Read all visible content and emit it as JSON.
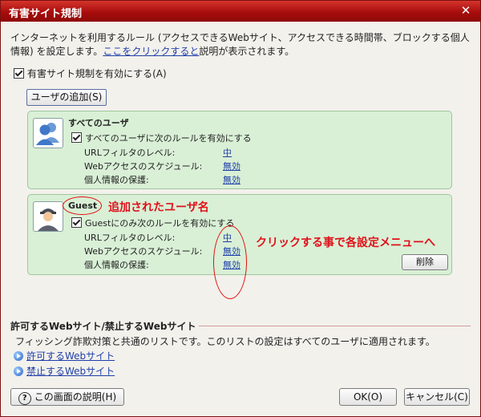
{
  "window": {
    "title": "有害サイト規制",
    "close_glyph": "✕"
  },
  "description": {
    "text_before": "インターネットを利用するルール (アクセスできるWebサイト、アクセスできる時間帯、ブロックする個人情報) を設定します。",
    "link": "ここをクリックすると",
    "text_after": "説明が表示されます。"
  },
  "enable": {
    "label": "有害サイト規制を有効にする(A)",
    "checked": true
  },
  "add_user_label": "ユーザの追加(S)",
  "users": [
    {
      "name": "すべてのユーザ",
      "rule_check_label": "すべてのユーザに次のルールを有効にする",
      "rows": [
        {
          "label": "URLフィルタのレベル:",
          "value": "中"
        },
        {
          "label": "Webアクセスのスケジュール:",
          "value": "無効"
        },
        {
          "label": "個人情報の保護:",
          "value": "無効"
        }
      ]
    },
    {
      "name": "Guest",
      "rule_check_label": "Guestにのみ次のルールを有効にする",
      "rows": [
        {
          "label": "URLフィルタのレベル:",
          "value": "中"
        },
        {
          "label": "Webアクセスのスケジュール:",
          "value": "無効"
        },
        {
          "label": "個人情報の保護:",
          "value": "無効"
        }
      ],
      "delete_label": "削除"
    }
  ],
  "annotations": {
    "added_user": "追加されたユーザ名",
    "click_to_settings": "クリックする事で各設定メニューへ",
    "color": "#e0101a"
  },
  "sites_section": {
    "title": "許可するWebサイト/禁止するWebサイト",
    "description": "フィッシング詐欺対策と共通のリストです。このリストの設定はすべてのユーザに適用されます。",
    "allow_link": "許可するWebサイト",
    "block_link": "禁止するWebサイト"
  },
  "footer": {
    "help_glyph": "?",
    "help_label": "この画面の説明(H)",
    "ok_label": "OK(O)",
    "cancel_label": "キャンセル(C)"
  },
  "colors": {
    "titlebar": "#a80d0d",
    "panel_bg": "#d9f0d6",
    "link": "#1f3fa8"
  }
}
